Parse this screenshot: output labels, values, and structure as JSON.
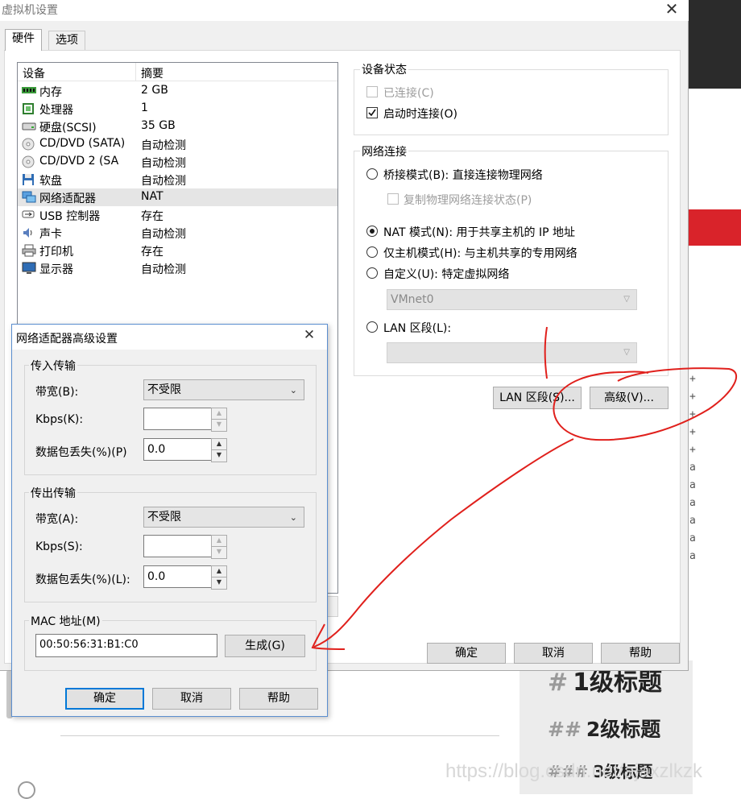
{
  "main_window": {
    "title": "虚拟机设置",
    "tabs": [
      "硬件",
      "选项"
    ],
    "device_list": {
      "headers": [
        "设备",
        "摘要"
      ],
      "rows": [
        {
          "icon": "memory-icon",
          "name": "内存",
          "summary": "2 GB"
        },
        {
          "icon": "cpu-icon",
          "name": "处理器",
          "summary": "1"
        },
        {
          "icon": "hard-disk-icon",
          "name": "硬盘(SCSI)",
          "summary": "35 GB"
        },
        {
          "icon": "cd-dvd-icon",
          "name": "CD/DVD (SATA)",
          "summary": "自动检测"
        },
        {
          "icon": "cd-dvd-icon",
          "name": "CD/DVD 2 (SA",
          "summary": "自动检测"
        },
        {
          "icon": "floppy-icon",
          "name": "软盘",
          "summary": "自动检测"
        },
        {
          "icon": "network-adapter-icon",
          "name": "网络适配器",
          "summary": "NAT",
          "selected": true
        },
        {
          "icon": "usb-icon",
          "name": "USB 控制器",
          "summary": "存在"
        },
        {
          "icon": "sound-icon",
          "name": "声卡",
          "summary": "自动检测"
        },
        {
          "icon": "printer-icon",
          "name": "打印机",
          "summary": "存在"
        },
        {
          "icon": "display-icon",
          "name": "显示器",
          "summary": "自动检测"
        }
      ]
    },
    "device_status": {
      "title": "设备状态",
      "connected_label": "已连接(C)",
      "connected_checked": false,
      "connected_enabled": false,
      "connect_at_power_on_label": "启动时连接(O)",
      "connect_at_power_on_checked": true
    },
    "network_connection": {
      "title": "网络连接",
      "bridged_label": "桥接模式(B): 直接连接物理网络",
      "replicate_label": "复制物理网络连接状态(P)",
      "nat_label": "NAT 模式(N): 用于共享主机的 IP 地址",
      "host_only_label": "仅主机模式(H): 与主机共享的专用网络",
      "custom_label": "自定义(U): 特定虚拟网络",
      "custom_network_value": "VMnet0",
      "lan_segment_label": "LAN 区段(L):",
      "selected": "nat"
    },
    "buttons": {
      "lan_segments": "LAN 区段(S)...",
      "advanced": "高级(V)...",
      "ok": "确定",
      "cancel": "取消",
      "help": "帮助"
    }
  },
  "advanced_dialog": {
    "title": "网络适配器高级设置",
    "incoming": {
      "title": "传入传输",
      "bandwidth_label": "带宽(B):",
      "bandwidth_value": "不受限",
      "kbps_label": "Kbps(K):",
      "kbps_value": "",
      "loss_label": "数据包丢失(%)(P)",
      "loss_value": "0.0"
    },
    "outgoing": {
      "title": "传出传输",
      "bandwidth_label": "带宽(A):",
      "bandwidth_value": "不受限",
      "kbps_label": "Kbps(S):",
      "kbps_value": "",
      "loss_label": "数据包丢失(%)(L):",
      "loss_value": "0.0"
    },
    "mac": {
      "title": "MAC 地址(M)",
      "value": "00:50:56:31:B1:C0",
      "generate_label": "生成(G)"
    },
    "buttons": {
      "ok": "确定",
      "cancel": "取消",
      "help": "帮助"
    }
  },
  "background_page": {
    "heading1": "1级标题",
    "heading2": "2级标题",
    "heading3": "3级标题",
    "hash1": "#",
    "hash2": "##",
    "hash3": "###",
    "side_marks": [
      "+",
      "+",
      "+",
      "+",
      "+",
      "a",
      "a",
      "a",
      "a",
      "a",
      "a"
    ],
    "watermark": "https://blog.csdn.net/ajaxzlkzk"
  },
  "colors": {
    "annotation": "#e0201c",
    "selection": "#e5e5e5",
    "default_button_border": "#0078d7"
  }
}
